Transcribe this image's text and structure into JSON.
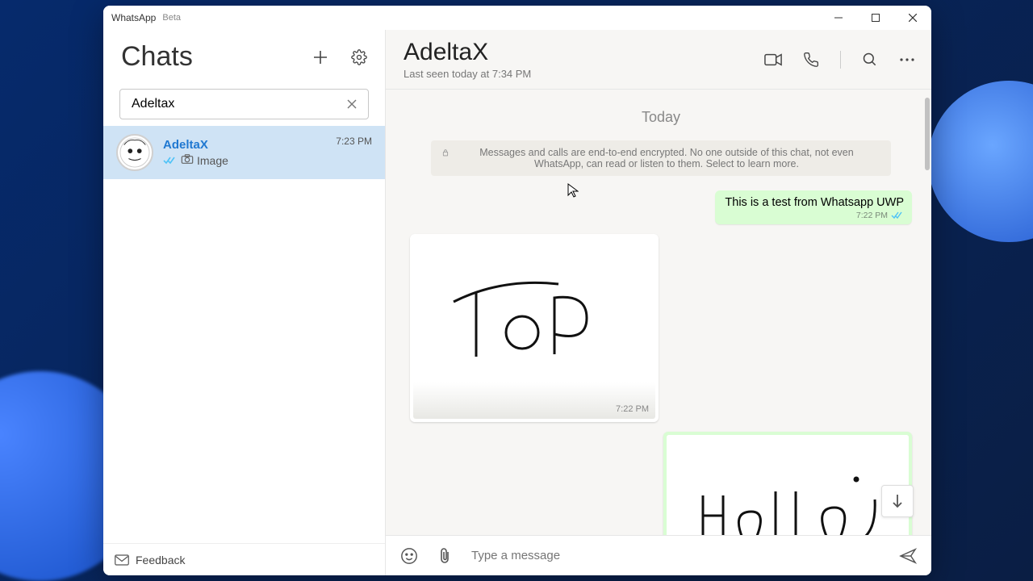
{
  "window": {
    "title": "WhatsApp",
    "suffix": "Beta"
  },
  "sidebar": {
    "heading": "Chats",
    "search_value": "Adeltax",
    "feedback_label": "Feedback",
    "items": [
      {
        "name": "AdeltaX",
        "preview": "Image",
        "time": "7:23 PM"
      }
    ]
  },
  "chat": {
    "contact_name": "AdeltaX",
    "status": "Last seen today at 7:34 PM",
    "day_label": "Today",
    "e2e_text": "Messages and calls are end-to-end encrypted. No one outside of this chat, not even WhatsApp, can read or listen to them. Select to learn more.",
    "messages": {
      "m1": {
        "text": "This is a test from Whatsapp UWP",
        "time": "7:22 PM"
      },
      "m2": {
        "time": "7:22 PM"
      }
    },
    "composer_placeholder": "Type a message"
  },
  "icons": {
    "new_chat": "plus-icon",
    "settings": "gear-icon",
    "video": "video-icon",
    "call": "phone-icon",
    "search": "search-icon",
    "more": "more-icon",
    "emoji": "emoji-icon",
    "attach": "attach-icon",
    "send": "send-icon",
    "mail": "mail-icon",
    "camera": "camera-icon",
    "lock": "lock-icon",
    "scroll_down": "arrow-down-icon",
    "clear": "close-icon"
  }
}
